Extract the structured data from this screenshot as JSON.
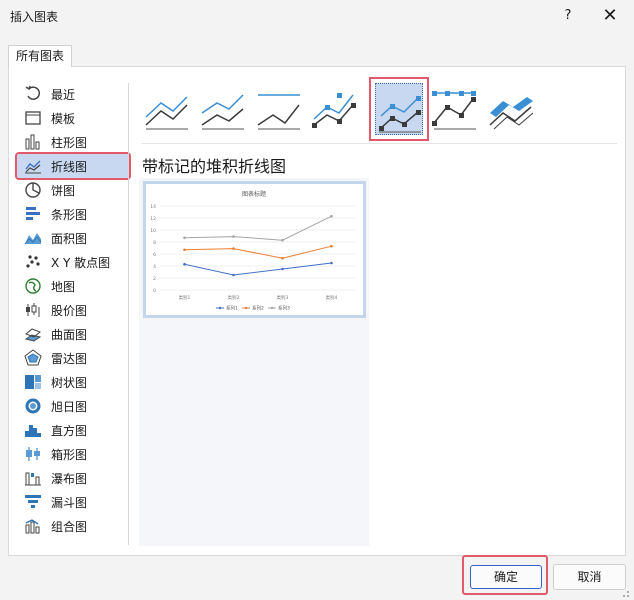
{
  "window": {
    "title": "插入图表",
    "help": "?",
    "close": "✕"
  },
  "tab": {
    "label": "所有图表"
  },
  "sidebar": {
    "items": [
      {
        "label": "最近",
        "icon": "recent-icon"
      },
      {
        "label": "模板",
        "icon": "template-icon"
      },
      {
        "label": "柱形图",
        "icon": "column-chart-icon"
      },
      {
        "label": "折线图",
        "icon": "line-chart-icon",
        "selected": true
      },
      {
        "label": "饼图",
        "icon": "pie-chart-icon"
      },
      {
        "label": "条形图",
        "icon": "bar-chart-icon"
      },
      {
        "label": "面积图",
        "icon": "area-chart-icon"
      },
      {
        "label": "X Y 散点图",
        "icon": "scatter-chart-icon"
      },
      {
        "label": "地图",
        "icon": "map-chart-icon"
      },
      {
        "label": "股价图",
        "icon": "stock-chart-icon"
      },
      {
        "label": "曲面图",
        "icon": "surface-chart-icon"
      },
      {
        "label": "雷达图",
        "icon": "radar-chart-icon"
      },
      {
        "label": "树状图",
        "icon": "treemap-chart-icon"
      },
      {
        "label": "旭日图",
        "icon": "sunburst-chart-icon"
      },
      {
        "label": "直方图",
        "icon": "histogram-chart-icon"
      },
      {
        "label": "箱形图",
        "icon": "box-whisker-chart-icon"
      },
      {
        "label": "瀑布图",
        "icon": "waterfall-chart-icon"
      },
      {
        "label": "漏斗图",
        "icon": "funnel-chart-icon"
      },
      {
        "label": "组合图",
        "icon": "combo-chart-icon"
      }
    ]
  },
  "subtypes": {
    "selected_index": 4,
    "selected_title": "带标记的堆积折线图"
  },
  "preview": {
    "chart_title": "图表标题",
    "categories": [
      "类别1",
      "类别2",
      "类别3",
      "类别4"
    ],
    "yticks": [
      "14",
      "12",
      "10",
      "8",
      "6",
      "4",
      "2",
      "0"
    ],
    "legend": [
      "系列1",
      "系列2",
      "系列3"
    ],
    "colors": [
      "#4472c4",
      "#ed7d31",
      "#a5a5a5"
    ],
    "series": [
      [
        4.3,
        2.5,
        3.5,
        4.5
      ],
      [
        6.7,
        6.9,
        5.3,
        7.3
      ],
      [
        8.7,
        8.9,
        8.3,
        12.3
      ]
    ]
  },
  "footer": {
    "ok_label": "确定",
    "cancel_label": "取消"
  }
}
